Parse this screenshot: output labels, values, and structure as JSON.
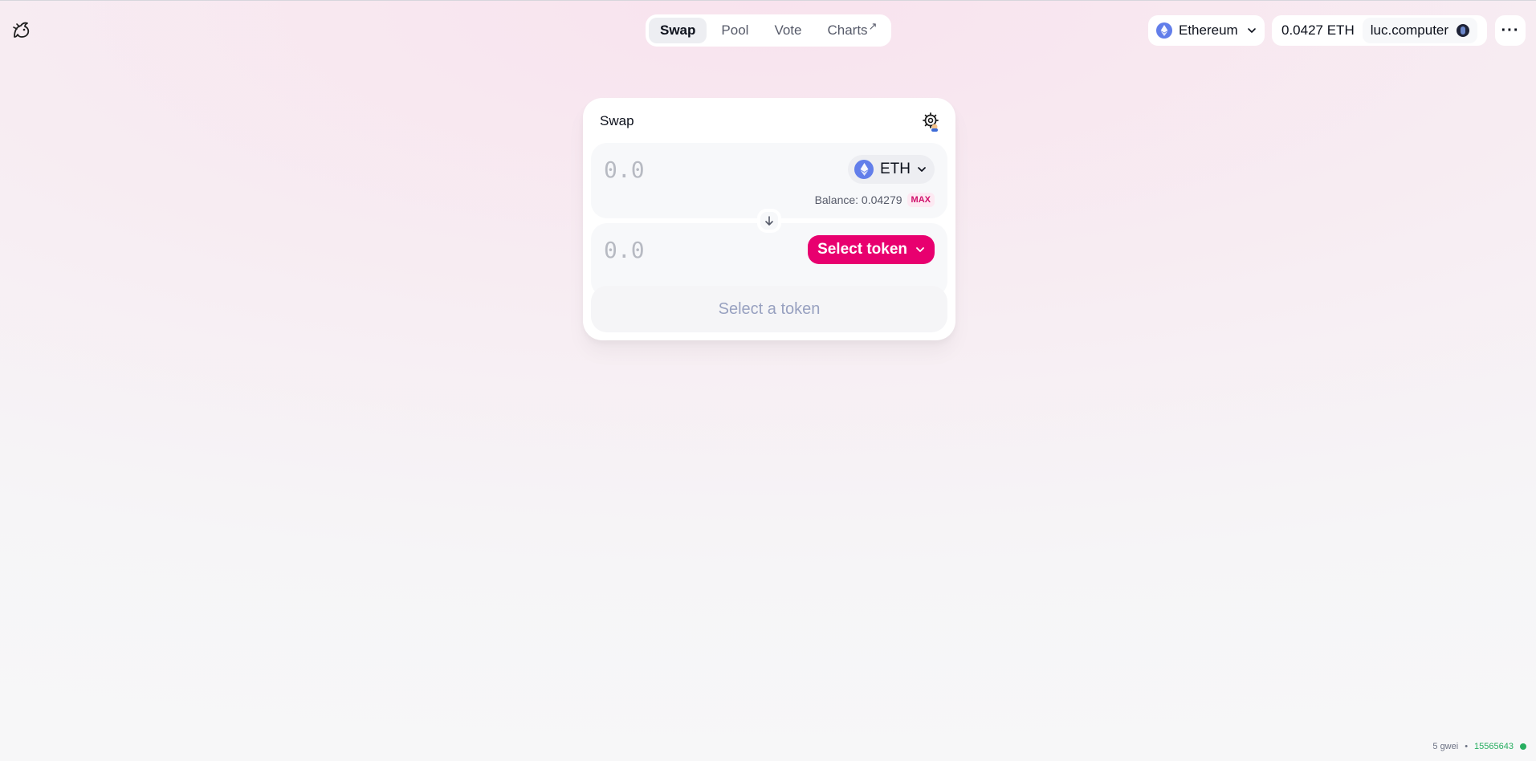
{
  "header": {
    "logo_icon": "uniswap-unicorn-icon",
    "nav": [
      {
        "label": "Swap",
        "active": true
      },
      {
        "label": "Pool",
        "active": false
      },
      {
        "label": "Vote",
        "active": false
      },
      {
        "label": "Charts",
        "active": false,
        "external_icon": "↗"
      }
    ],
    "network": {
      "label": "Ethereum",
      "icon": "ethereum-icon"
    },
    "account": {
      "balance": "0.0427 ETH",
      "name": "luc.computer"
    },
    "more_label": "···"
  },
  "swap": {
    "title": "Swap",
    "settings_icon": "gear-icon",
    "input": {
      "placeholder": "0.0",
      "token": "ETH",
      "balance_text": "Balance: 0.04279",
      "max_label": "MAX"
    },
    "output": {
      "placeholder": "0.0",
      "select_label": "Select token"
    },
    "cta_label": "Select a token"
  },
  "footer": {
    "gas": "5 gwei",
    "separator": "•",
    "block": "15565643"
  },
  "colors": {
    "accent": "#e8006f",
    "eth": "#627eea",
    "status": "#27ae60"
  }
}
